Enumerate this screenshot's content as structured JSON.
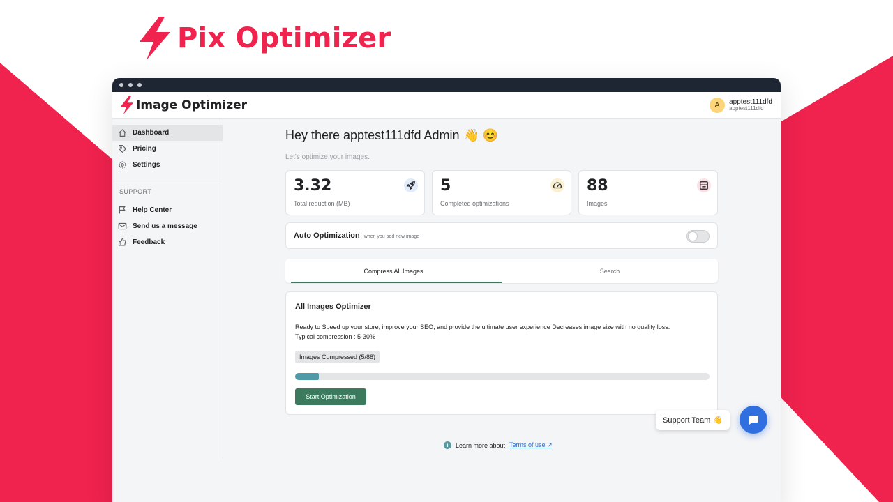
{
  "brand": {
    "title": "Pix Optimizer",
    "color": "#f0224e"
  },
  "app": {
    "name": "Image Optimizer"
  },
  "user": {
    "avatar_letter": "A",
    "name": "apptest111dfd",
    "sub": "apptest111dfd"
  },
  "sidebar": {
    "items": [
      {
        "label": "Dashboard",
        "icon": "home-icon",
        "active": true
      },
      {
        "label": "Pricing",
        "icon": "tag-icon"
      },
      {
        "label": "Settings",
        "icon": "gear-icon"
      }
    ],
    "support_heading": "SUPPORT",
    "support_items": [
      {
        "label": "Help Center",
        "icon": "flag-icon"
      },
      {
        "label": "Send us a message",
        "icon": "mail-icon"
      },
      {
        "label": "Feedback",
        "icon": "thumb-icon"
      }
    ]
  },
  "main": {
    "greeting": "Hey there apptest111dfd Admin",
    "greeting_emoji": "👋 😊",
    "subtitle": "Let's optimize your images.",
    "stats": [
      {
        "value": "3.32",
        "label": "Total reduction (MB)",
        "icon": "rocket-icon"
      },
      {
        "value": "5",
        "label": "Completed optimizations",
        "icon": "gauge-icon"
      },
      {
        "value": "88",
        "label": "Images",
        "icon": "image-gallery-icon"
      }
    ],
    "auto": {
      "title": "Auto Optimization",
      "note": "when you add new image",
      "enabled": false
    },
    "tabs": [
      {
        "label": "Compress All Images",
        "active": true
      },
      {
        "label": "Search"
      }
    ],
    "card": {
      "title": "All Images Optimizer",
      "desc_line1": "Ready to Speed up your store, improve your SEO, and provide the ultimate user experience Decreases image size with no quality loss.",
      "desc_line2": "Typical compression : 5-30%",
      "badge": "Images Compressed (5/88)",
      "progress": 0.0568,
      "button": "Start Optimization"
    },
    "footer": {
      "text": "Learn more about",
      "link": "Terms of use"
    }
  },
  "support": {
    "label": "Support Team",
    "emoji": "👋"
  },
  "colors": {
    "accent_green": "#3c7a5e",
    "progress": "#4f9aa6",
    "chat": "#2f6fe0"
  }
}
